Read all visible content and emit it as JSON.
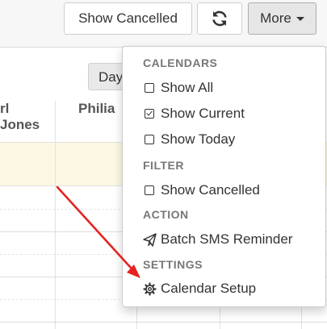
{
  "toolbar": {
    "show_cancelled_label": "Show Cancelled",
    "refresh_icon": "refresh-icon",
    "more_label": "More"
  },
  "calendar": {
    "view_button": "Day",
    "columns": [
      "rl Jones",
      "Philia"
    ]
  },
  "menu": {
    "sections": {
      "calendars": "CALENDARS",
      "filter": "FILTER",
      "action": "ACTION",
      "settings": "SETTINGS"
    },
    "items": {
      "show_all": {
        "label": "Show All",
        "checked": false
      },
      "show_current": {
        "label": "Show Current",
        "checked": true
      },
      "show_today": {
        "label": "Show Today",
        "checked": false
      },
      "show_cancelled": {
        "label": "Show Cancelled",
        "checked": false
      },
      "batch_sms": {
        "label": "Batch SMS Reminder",
        "icon": "paper-plane-icon"
      },
      "calendar_setup": {
        "label": "Calendar Setup",
        "icon": "gear-icon"
      }
    }
  },
  "annotation": {
    "arrow_color": "#e52222"
  },
  "colors": {
    "highlight_row": "#fcf8e3",
    "more_button_active": "#e6e6e6"
  }
}
